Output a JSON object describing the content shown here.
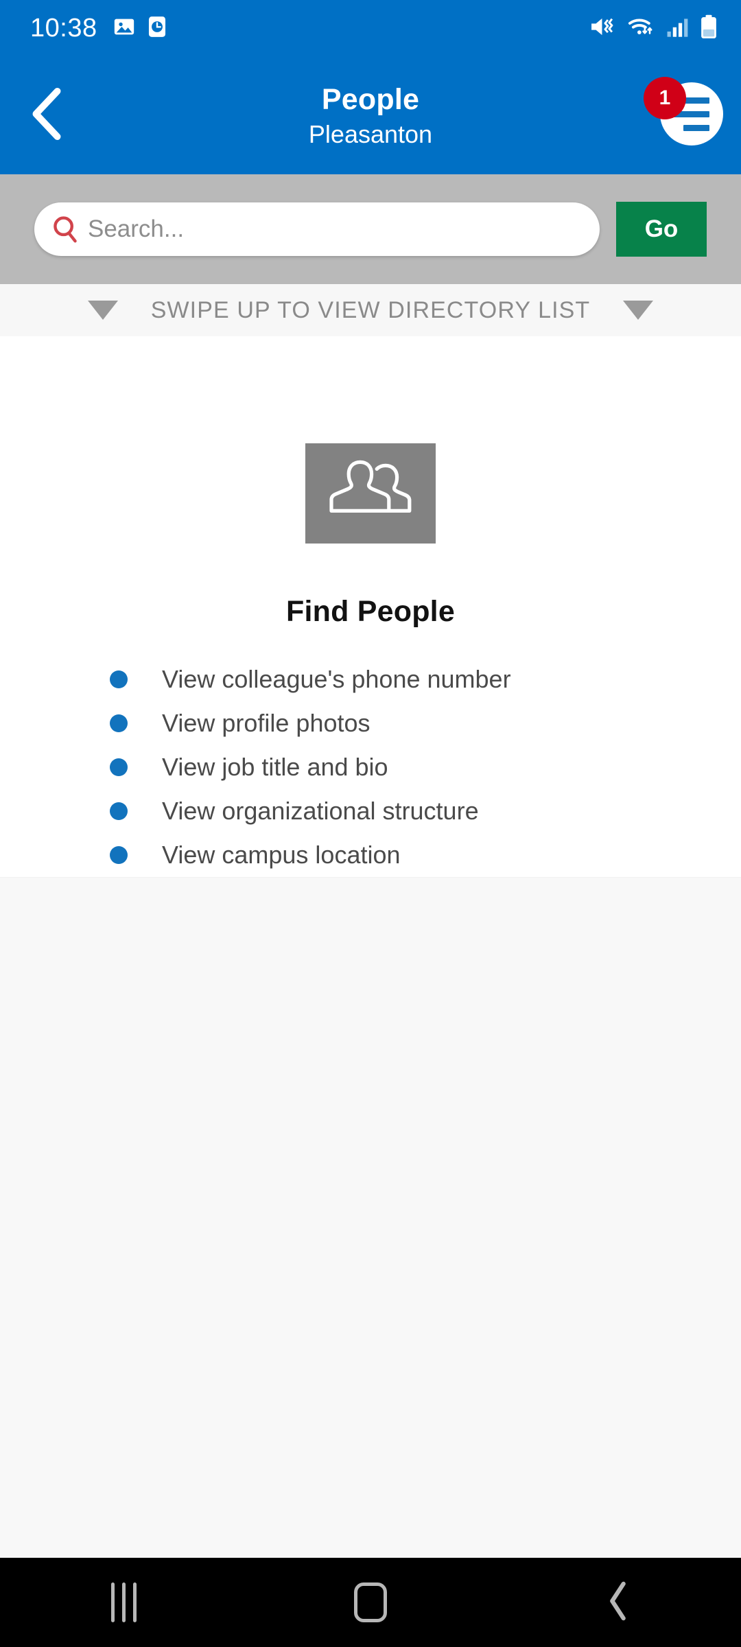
{
  "status_bar": {
    "time": "10:38",
    "left_icons": [
      "image-icon",
      "alarm-clock-icon"
    ],
    "right_icons": [
      "mute-icon",
      "wifi-icon",
      "cellular-signal-icon",
      "battery-icon"
    ],
    "background_color": "#0070c5"
  },
  "header": {
    "back_label": "back-chevron",
    "title": "People",
    "subtitle": "Pleasanton",
    "menu_label": "menu-icon",
    "badge_count": "1",
    "badge_color": "#d00017",
    "background_color": "#0070c5"
  },
  "search": {
    "placeholder": "Search...",
    "value": "",
    "icon": "search-icon",
    "icon_color": "#d1434b",
    "go_label": "Go",
    "go_color": "#07824a",
    "band_color": "#b9b9b9"
  },
  "swipe_banner": {
    "text": "SWIPE UP TO VIEW DIRECTORY LIST",
    "left_icon": "triangle-down-icon",
    "right_icon": "triangle-down-icon",
    "background_color": "#f7f7f7"
  },
  "main": {
    "tile_icon": "people-icon",
    "tile_color": "#828282",
    "heading": "Find People",
    "bullet_color": "#1273bd",
    "bullets": [
      "View colleague's phone number",
      "View profile photos",
      "View job title and bio",
      "View organizational structure",
      "View campus location"
    ]
  },
  "nav_bar": {
    "recents_label": "recents-icon",
    "home_label": "home-icon",
    "back_label": "back-icon",
    "background_color": "#000000"
  }
}
